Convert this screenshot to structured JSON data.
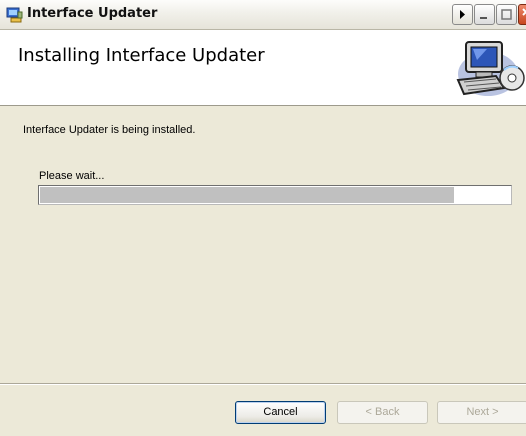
{
  "window": {
    "title": "Interface Updater",
    "icon": "installer-app-icon"
  },
  "banner": {
    "title": "Installing Interface Updater",
    "art_icon": "computer-with-cd-icon"
  },
  "body": {
    "status": "Interface Updater is being installed.",
    "wait_label": "Please wait...",
    "progress_percent": 88
  },
  "buttons": {
    "cancel": "Cancel",
    "back": "< Back",
    "next": "Next >"
  }
}
